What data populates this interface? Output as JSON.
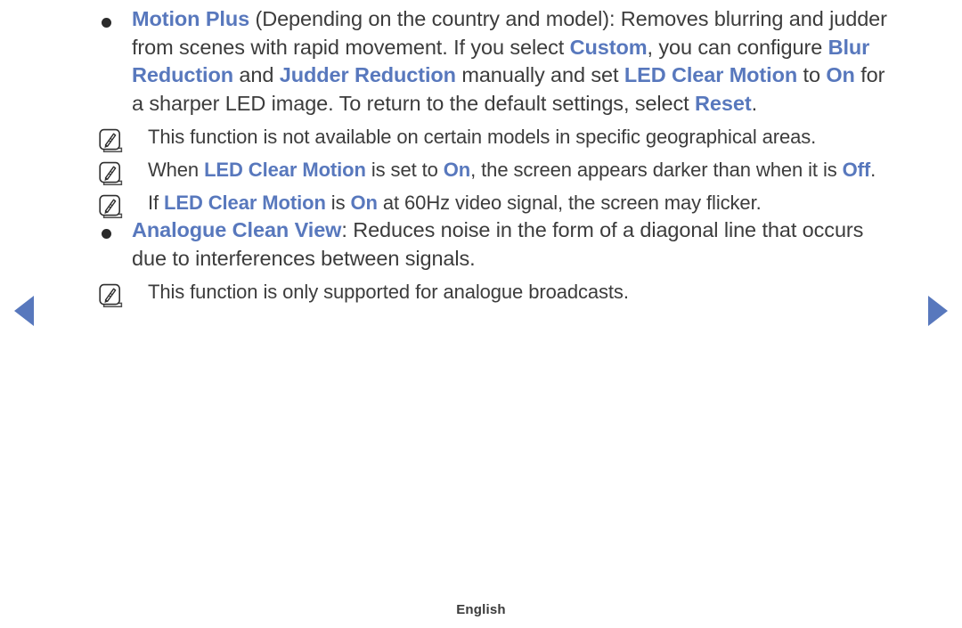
{
  "accent_color": "#5878bd",
  "text_color": "#3c3c3c",
  "nav": {
    "prev_label": "previous-page-arrow",
    "next_label": "next-page-arrow"
  },
  "sections": [
    {
      "type": "bullet",
      "title": "Motion Plus",
      "segments": [
        {
          "text": "Motion Plus",
          "style": "keyword"
        },
        {
          "text": " (Depending on the country and model): Removes blurring and judder from scenes with rapid movement. If you select ",
          "style": "normal"
        },
        {
          "text": "Custom",
          "style": "keyword"
        },
        {
          "text": ", you can configure ",
          "style": "normal"
        },
        {
          "text": "Blur Reduction",
          "style": "keyword"
        },
        {
          "text": " and ",
          "style": "normal"
        },
        {
          "text": "Judder Reduction",
          "style": "keyword"
        },
        {
          "text": " manually and set ",
          "style": "normal"
        },
        {
          "text": "LED Clear Motion",
          "style": "keyword"
        },
        {
          "text": " to ",
          "style": "normal"
        },
        {
          "text": "On",
          "style": "keyword"
        },
        {
          "text": " for a sharper LED image. To return to the default settings, select ",
          "style": "normal"
        },
        {
          "text": "Reset",
          "style": "keyword"
        },
        {
          "text": ".",
          "style": "normal"
        }
      ],
      "notes": [
        {
          "icon": "note-pencil-icon",
          "segments": [
            {
              "text": "This function is not available on certain models in specific geographical areas.",
              "style": "normal"
            }
          ]
        },
        {
          "icon": "note-pencil-icon",
          "segments": [
            {
              "text": "When ",
              "style": "normal"
            },
            {
              "text": "LED Clear Motion",
              "style": "keyword"
            },
            {
              "text": " is set to ",
              "style": "normal"
            },
            {
              "text": "On",
              "style": "keyword"
            },
            {
              "text": ", the screen appears darker than when it is ",
              "style": "normal"
            },
            {
              "text": "Off",
              "style": "keyword"
            },
            {
              "text": ".",
              "style": "normal"
            }
          ]
        },
        {
          "icon": "note-pencil-icon",
          "segments": [
            {
              "text": "If ",
              "style": "normal"
            },
            {
              "text": "LED Clear Motion",
              "style": "keyword"
            },
            {
              "text": " is ",
              "style": "normal"
            },
            {
              "text": "On",
              "style": "keyword"
            },
            {
              "text": " at 60Hz video signal, the screen may flicker.",
              "style": "normal"
            }
          ]
        }
      ]
    },
    {
      "type": "bullet",
      "title": "Analogue Clean View",
      "segments": [
        {
          "text": "Analogue Clean View",
          "style": "keyword"
        },
        {
          "text": ": Reduces noise in the form of a diagonal line that occurs due to interferences between signals.",
          "style": "normal"
        }
      ],
      "notes": [
        {
          "icon": "note-pencil-icon",
          "segments": [
            {
              "text": "This function is only supported for analogue broadcasts.",
              "style": "normal"
            }
          ]
        }
      ]
    }
  ],
  "footer": {
    "language": "English"
  }
}
